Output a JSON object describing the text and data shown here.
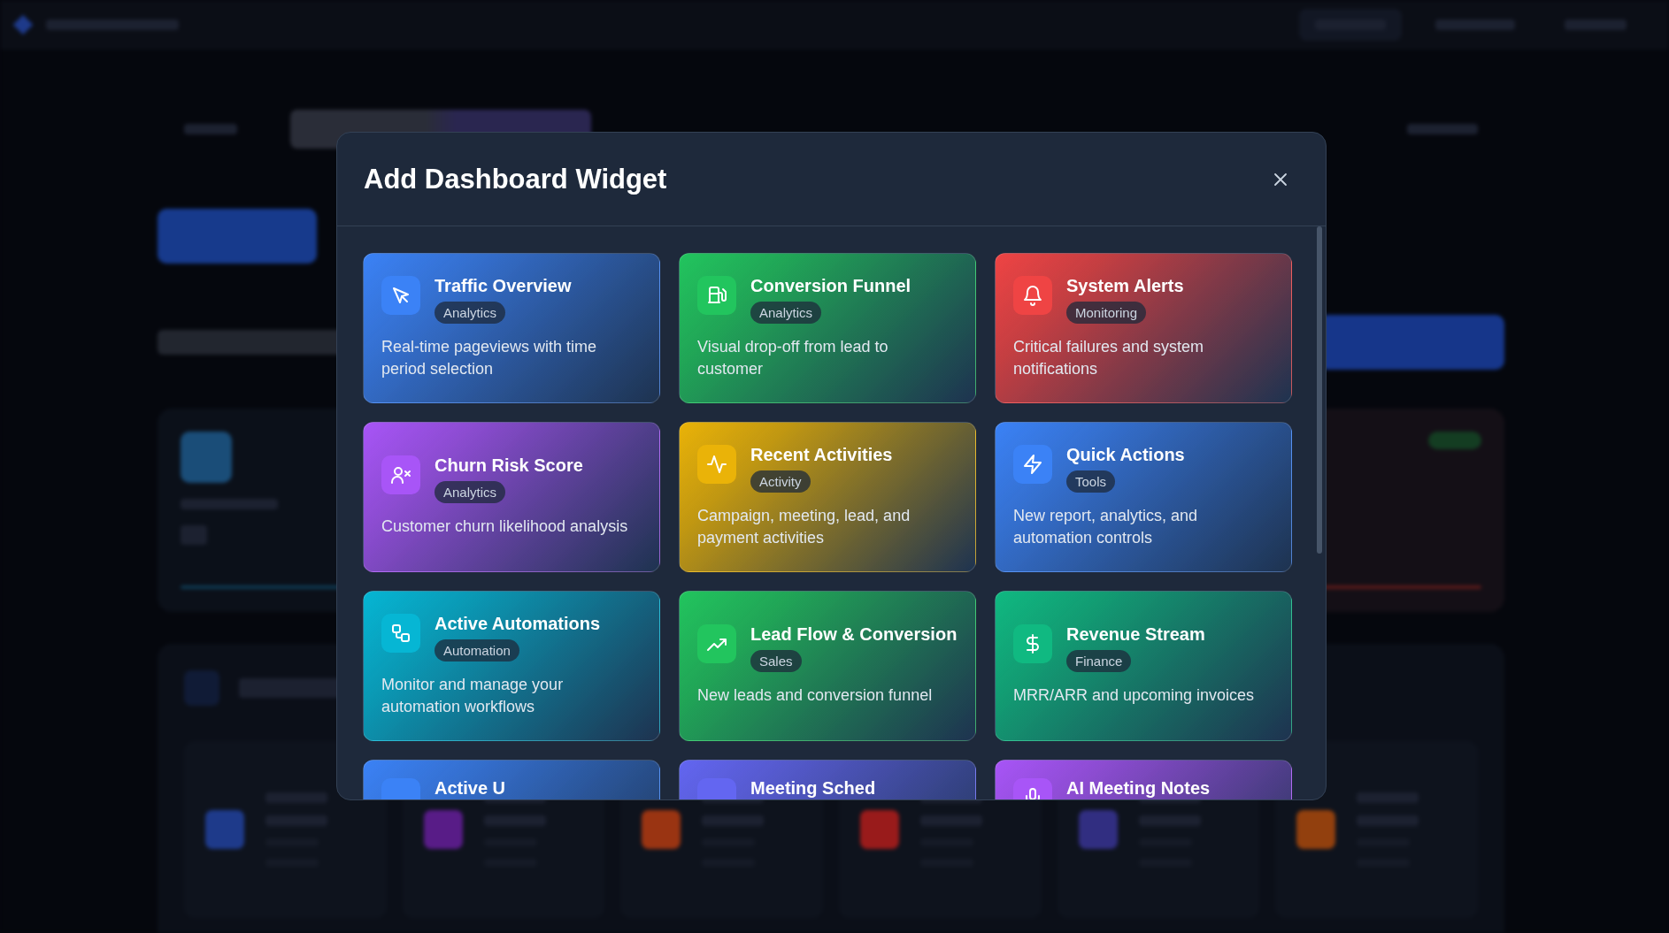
{
  "modal": {
    "title": "Add Dashboard Widget",
    "widgets": [
      {
        "title": "Traffic Overview",
        "tag": "Analytics",
        "description": "Real-time pageviews with time period selection",
        "color": "#3b82f6"
      },
      {
        "title": "Conversion Funnel",
        "tag": "Analytics",
        "description": "Visual drop-off from lead to customer",
        "color": "#22c55e"
      },
      {
        "title": "System Alerts",
        "tag": "Monitoring",
        "description": "Critical failures and system notifications",
        "color": "#ef4444"
      },
      {
        "title": "Churn Risk Score",
        "tag": "Analytics",
        "description": "Customer churn likelihood analysis",
        "color": "#a855f7"
      },
      {
        "title": "Recent Activities",
        "tag": "Activity",
        "description": "Campaign, meeting, lead, and payment activities",
        "color": "#eab308"
      },
      {
        "title": "Quick Actions",
        "tag": "Tools",
        "description": "New report, analytics, and automation controls",
        "color": "#3b82f6"
      },
      {
        "title": "Active Automations",
        "tag": "Automation",
        "description": "Monitor and manage your automation workflows",
        "color": "#06b6d4"
      },
      {
        "title": "Lead Flow & Conversion",
        "tag": "Sales",
        "description": "New leads and conversion funnel",
        "color": "#22c55e"
      },
      {
        "title": "Revenue Stream",
        "tag": "Finance",
        "description": "MRR/ARR and upcoming invoices",
        "color": "#10b981"
      },
      {
        "title": "Active U",
        "color": "#3b82f6"
      },
      {
        "title": "Meeting Sched",
        "color": "#6366f1"
      },
      {
        "title": "AI Meeting Notes",
        "color": "#a855f7"
      }
    ]
  }
}
